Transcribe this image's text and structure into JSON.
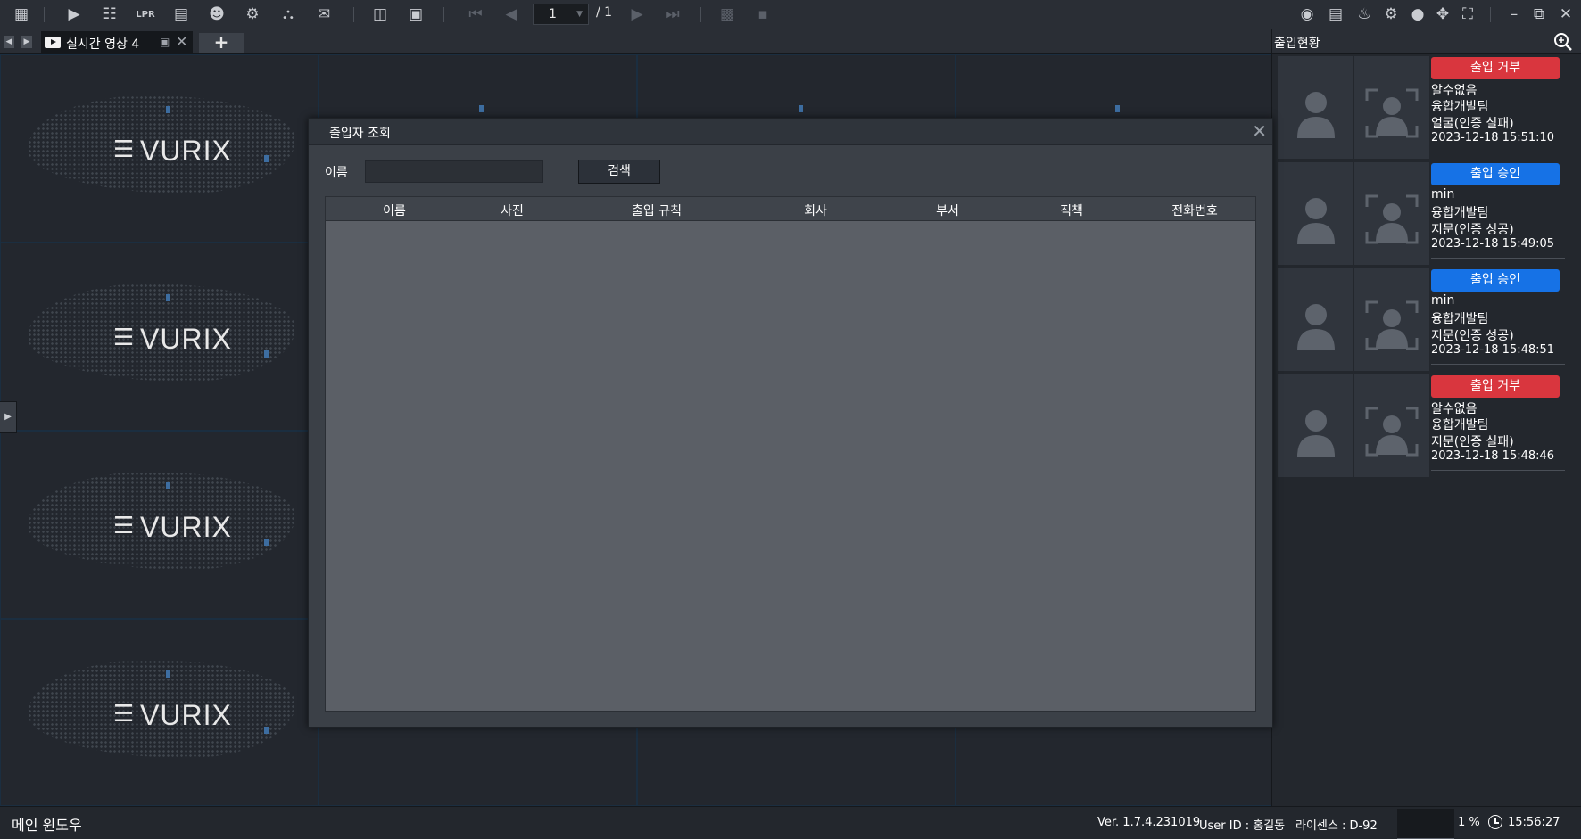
{
  "toolbar": {
    "page_current": "1",
    "page_total": "/ 1"
  },
  "tabs": [
    {
      "label": "실시간 영상 4"
    }
  ],
  "grid": {
    "brand": "VURIX"
  },
  "access_panel": {
    "title": "출입현황",
    "events": [
      {
        "status": "출입 거부",
        "status_color": "#d9363e",
        "name": "알수없음",
        "team": "융합개발팀",
        "method": "얼굴(인증 실패)",
        "time": "2023-12-18 15:51:10"
      },
      {
        "status": "출입 승인",
        "status_color": "#1672e6",
        "name": "min",
        "team": "융합개발팀",
        "method": "지문(인증 성공)",
        "time": "2023-12-18 15:49:05"
      },
      {
        "status": "출입 승인",
        "status_color": "#1672e6",
        "name": "min",
        "team": "융합개발팀",
        "method": "지문(인증 성공)",
        "time": "2023-12-18 15:48:51"
      },
      {
        "status": "출입 거부",
        "status_color": "#d9363e",
        "name": "알수없음",
        "team": "융합개발팀",
        "method": "지문(인증 실패)",
        "time": "2023-12-18 15:48:46"
      }
    ]
  },
  "dialog": {
    "title": "출입자 조회",
    "name_label": "이름",
    "name_value": "",
    "search_button": "검색",
    "columns": [
      "이름",
      "사진",
      "출입 규칙",
      "회사",
      "부서",
      "직책",
      "전화번호"
    ],
    "rows": []
  },
  "statusbar": {
    "window_title": "메인 윈도우",
    "version": "Ver. 1.7.4.231019",
    "user": "User ID : 홍길동",
    "license": "라이센스 : D-92",
    "cpu": "1 %",
    "clock": "15:56:27"
  }
}
